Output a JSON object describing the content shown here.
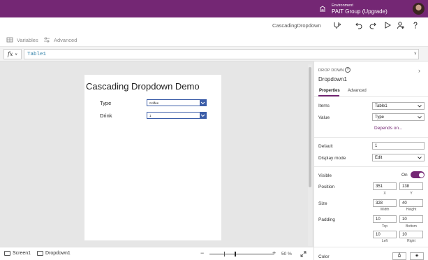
{
  "topbar": {
    "environment_label": "Environment",
    "environment_name": "PAIT Group (Upgrade)",
    "env_icon": "building-icon",
    "avatar": "user-avatar"
  },
  "command_bar": {
    "app_name": "CascadingDropdown",
    "icons": [
      "app-checker-icon",
      "undo-icon",
      "redo-icon",
      "play-icon",
      "share-user-icon",
      "help-icon"
    ]
  },
  "toolbar": {
    "variables_label": "Variables",
    "advanced_label": "Advanced"
  },
  "formula_bar": {
    "fx_label": "fx",
    "value": "Table1"
  },
  "canvas": {
    "title": "Cascading Dropdown Demo",
    "type_label": "Type",
    "type_value": "Coffee",
    "drink_label": "Drink",
    "drink_value": "1"
  },
  "bottom_bar": {
    "screen_tab": "Screen1",
    "control_tab": "Dropdown1",
    "zoom_minus": "−",
    "zoom_plus": "+",
    "zoom_value": "50  %",
    "zoom_level_percent": 50
  },
  "panel": {
    "kind": "DROP DOWN",
    "control_name": "Dropdown1",
    "tabs": [
      "Properties",
      "Advanced"
    ],
    "items_label": "Items",
    "items_value": "Table1",
    "value_label": "Value",
    "value_value": "Type",
    "depends_on": "Depends on...",
    "default_label": "Default",
    "default_value": "1",
    "display_mode_label": "Display mode",
    "display_mode_value": "Edit",
    "visible_label": "Visible",
    "visible_state": "On",
    "position_label": "Position",
    "pos_x": "351",
    "pos_y": "138",
    "x_caption": "X",
    "y_caption": "Y",
    "size_label": "Size",
    "width": "328",
    "height": "40",
    "width_caption": "Width",
    "height_caption": "Height",
    "padding_label": "Padding",
    "pad_top": "10",
    "pad_bottom": "10",
    "pad_left": "10",
    "pad_right": "10",
    "top_caption": "Top",
    "bottom_caption": "Bottom",
    "left_caption": "Left",
    "right_caption": "Right",
    "color_label": "Color",
    "color_text": "A",
    "accent": "#742774"
  }
}
